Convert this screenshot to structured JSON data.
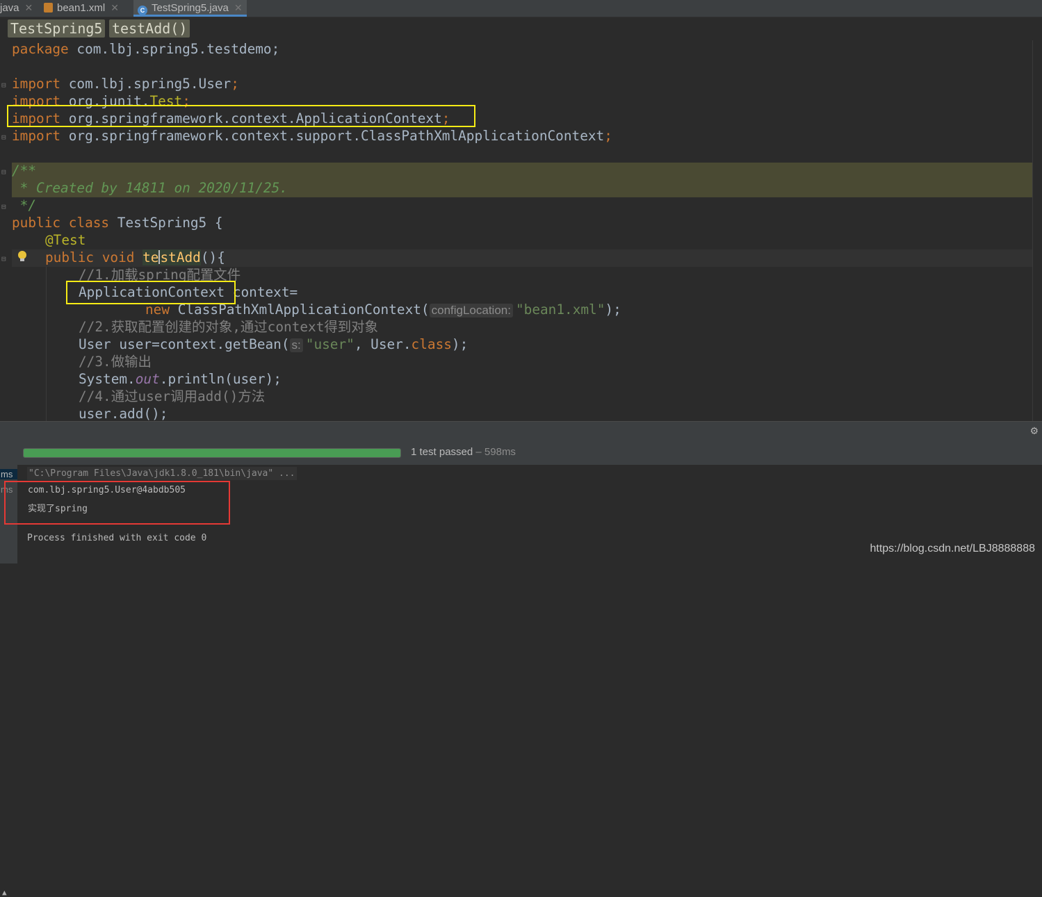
{
  "tabs": [
    {
      "label": "java",
      "icon": "java-file-icon"
    },
    {
      "label": "bean1.xml",
      "icon": "xml-file-icon"
    },
    {
      "label": "TestSpring5.java",
      "icon": "java-class-icon",
      "active": true
    }
  ],
  "breadcrumb": [
    "TestSpring5",
    "testAdd()"
  ],
  "code": {
    "package": "com.lbj.spring5.testdemo;",
    "imports": [
      "com.lbj.spring5.User",
      "org.junit.",
      "Test",
      "org.springframework.context.ApplicationContext",
      "org.springframework.context.support.ClassPathXmlApplicationContext"
    ],
    "kw_package": "package",
    "kw_import": "import",
    "doc_open": "/**",
    "doc_body": " * Created by 14811 on 2020/11/25.",
    "doc_close": " */",
    "kw_public": "public",
    "kw_class": "class",
    "class_name": "TestSpring5 {",
    "annotation": "@Test",
    "kw_void": "void",
    "method_a": "te",
    "method_b": "stAdd",
    "method_tail": "(){",
    "c1": "//1.加载spring配置文件",
    "appctx": "ApplicationContext",
    "ctx_assign": " context=",
    "kw_new": "new",
    "cpx": " ClassPathXmlApplicationContext(",
    "hint_config": "configLocation:",
    "str_bean": "\"bean1.xml\"",
    "close_paren": ");",
    "c2": "//2.获取配置创建的对象,通过context得到对象",
    "getbean": "User user=context.getBean(",
    "hint_s": "s:",
    "str_user": "\"user\"",
    "user_class": ", User.",
    "kw_class2": "class",
    "c3": "//3.做输出",
    "sys": "System.",
    "out": "out",
    "println": ".println(user);",
    "c4": "//4.通过user调用add()方法",
    "add": "user.add();",
    "semi": ";"
  },
  "test_runner": {
    "progress": 1.0,
    "result": "1 test passed",
    "duration": " – 598ms",
    "ms_labels": [
      "ms",
      "ms"
    ]
  },
  "console": {
    "command": "\"C:\\Program Files\\Java\\jdk1.8.0_181\\bin\\java\" ...",
    "out1": "com.lbj.spring5.User@4abdb505",
    "out2": "实现了spring",
    "exit": "Process finished with exit code 0"
  },
  "watermark": "https://blog.csdn.net/LBJ8888888"
}
